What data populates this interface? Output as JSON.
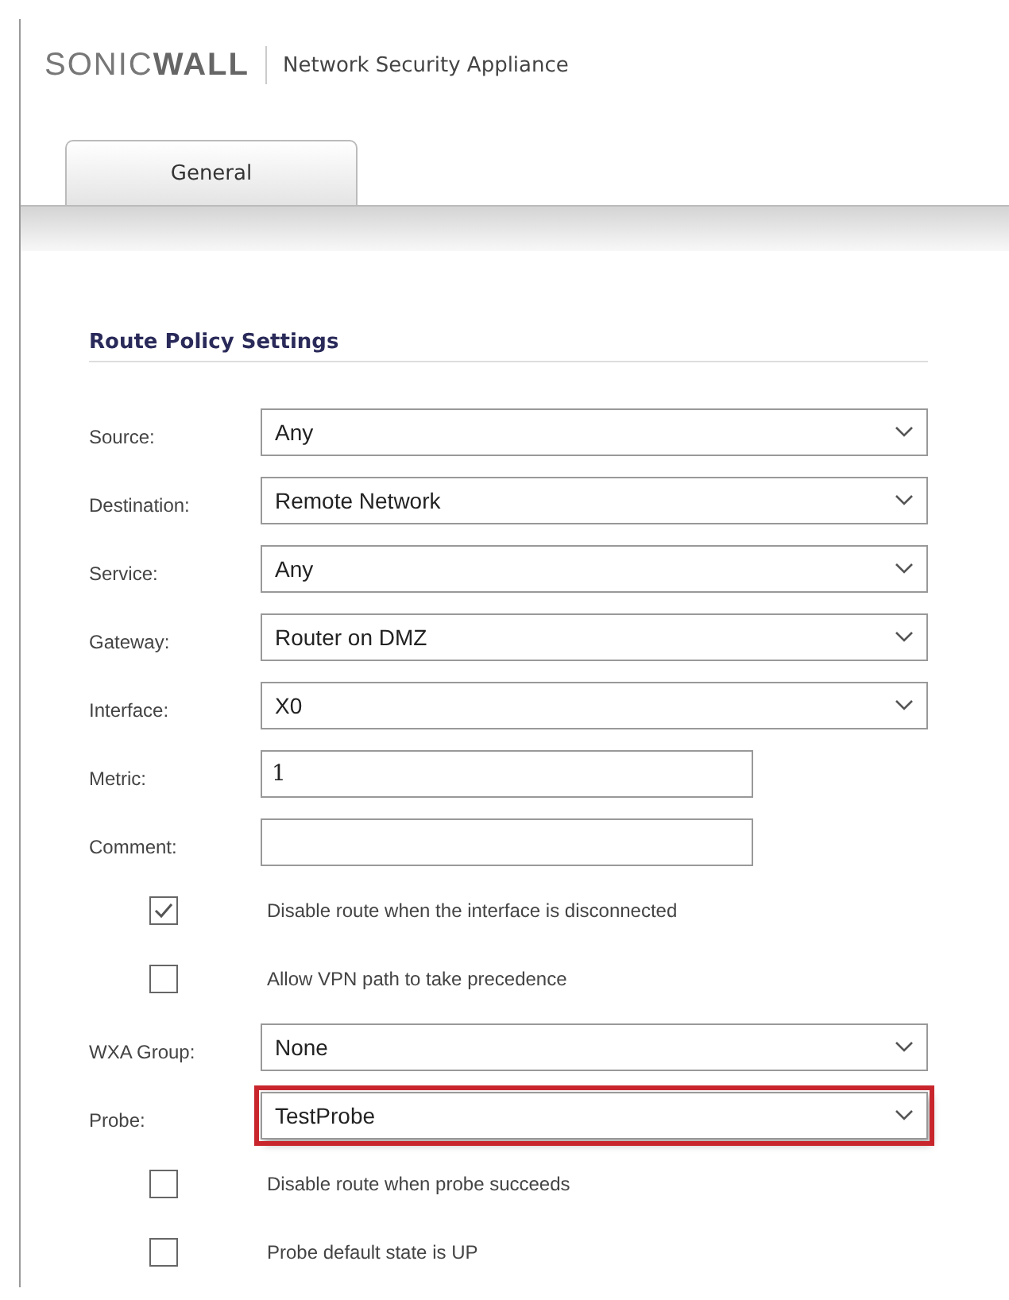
{
  "header": {
    "brand": {
      "light": "SONIC",
      "bold": "WALL"
    },
    "product": "Network Security Appliance"
  },
  "tabs": [
    {
      "label": "General",
      "selected": true
    }
  ],
  "section": {
    "title": "Route Policy Settings"
  },
  "fields": [
    {
      "kind": "select",
      "label": "Source:",
      "value": "Any",
      "highlighted": false
    },
    {
      "kind": "select",
      "label": "Destination:",
      "value": "Remote Network",
      "highlighted": false
    },
    {
      "kind": "select",
      "label": "Service:",
      "value": "Any",
      "highlighted": false
    },
    {
      "kind": "select",
      "label": "Gateway:",
      "value": "Router on DMZ",
      "highlighted": false
    },
    {
      "kind": "select",
      "label": "Interface:",
      "value": "X0",
      "highlighted": false
    },
    {
      "kind": "text",
      "label": "Metric:",
      "value": "1"
    },
    {
      "kind": "text",
      "label": "Comment:"
    },
    {
      "kind": "checkbox",
      "label": "Disable route when the interface is disconnected",
      "checked": true
    },
    {
      "kind": "checkbox",
      "label": "Allow VPN path to take precedence",
      "checked": false
    },
    {
      "kind": "select",
      "label": "WXA Group:",
      "value": "None",
      "highlighted": false
    },
    {
      "kind": "select",
      "label": "Probe:",
      "value": "TestProbe",
      "highlighted": true
    },
    {
      "kind": "checkbox",
      "label": "Disable route when probe succeeds",
      "checked": false
    },
    {
      "kind": "checkbox",
      "label": "Probe default state is UP",
      "checked": false
    }
  ]
}
